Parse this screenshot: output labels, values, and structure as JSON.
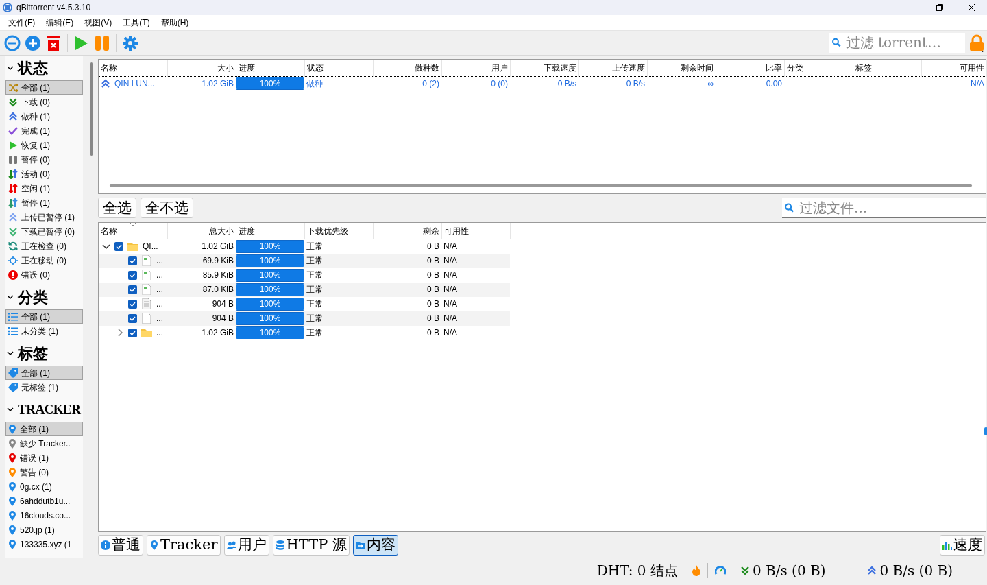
{
  "window": {
    "title": "qBittorrent v4.5.3.10"
  },
  "menu": [
    "文件(F)",
    "编辑(E)",
    "视图(V)",
    "工具(T)",
    "帮助(H)"
  ],
  "search": {
    "placeholder": "过滤 torrent…"
  },
  "sidebar": [
    {
      "heading": "状态",
      "expanded": true,
      "items": [
        {
          "label": "全部 (1)",
          "selected": true
        },
        {
          "label": "下载 (0)",
          "selected": false
        },
        {
          "label": "做种 (1)",
          "selected": false
        },
        {
          "label": "完成 (1)",
          "selected": false
        },
        {
          "label": "恢复 (1)",
          "selected": false
        },
        {
          "label": "暂停 (0)",
          "selected": false
        },
        {
          "label": "活动 (0)",
          "selected": false
        },
        {
          "label": "空闲 (1)",
          "selected": false
        },
        {
          "label": "暂停 (1)",
          "selected": false
        },
        {
          "label": "上传已暂停 (1)",
          "selected": false
        },
        {
          "label": "下载已暂停 (0)",
          "selected": false
        },
        {
          "label": "正在检查 (0)",
          "selected": false
        },
        {
          "label": "正在移动 (0)",
          "selected": false
        },
        {
          "label": "错误 (0)",
          "selected": false
        }
      ]
    },
    {
      "heading": "分类",
      "expanded": true,
      "items": [
        {
          "label": "全部 (1)",
          "selected": true
        },
        {
          "label": "未分类 (1)",
          "selected": false
        }
      ]
    },
    {
      "heading": "标签",
      "expanded": true,
      "items": [
        {
          "label": "全部 (1)",
          "selected": true
        },
        {
          "label": "无标签 (1)",
          "selected": false
        }
      ]
    },
    {
      "heading": "TRACKER",
      "expanded": true,
      "items": [
        {
          "label": "全部 (1)",
          "selected": true,
          "color": "#1e88e5"
        },
        {
          "label": "缺少 Tracker..",
          "selected": false,
          "color": "#888888"
        },
        {
          "label": "错误 (1)",
          "selected": false,
          "color": "#e50000"
        },
        {
          "label": "警告 (0)",
          "selected": false,
          "color": "#ff8c00"
        },
        {
          "label": "0g.cx (1)",
          "selected": false,
          "color": "#1e88e5"
        },
        {
          "label": "6ahddutb1u...",
          "selected": false,
          "color": "#1e88e5"
        },
        {
          "label": "16clouds.co...",
          "selected": false,
          "color": "#1e88e5"
        },
        {
          "label": "520.jp (1)",
          "selected": false,
          "color": "#1e88e5"
        },
        {
          "label": "133335.xyz (1",
          "selected": false,
          "color": "#1e88e5"
        }
      ]
    }
  ],
  "torrents": {
    "columns": [
      "名称",
      "大小",
      "进度",
      "状态",
      "做种数",
      "用户",
      "下载速度",
      "上传速度",
      "剩余时间",
      "比率",
      "分类",
      "标签",
      "可用性"
    ],
    "rows": [
      {
        "selected": false,
        "name": "QIN LUN...",
        "size": "1.02 GiB",
        "level": 1,
        "progress": "100%",
        "status": "做种",
        "seeds": "0 (2)",
        "peers": "0 (0)",
        "down": "0 B/s",
        "up": "0 B/s",
        "eta": "∞",
        "ratio": "0.00",
        "availability": "N/A"
      }
    ]
  },
  "content": {
    "select_all": "全选",
    "select_none": "全不选",
    "filter": {
      "placeholder": "过滤文件..."
    },
    "columns": [
      "名称",
      "总大小",
      "进度",
      "下载优先级",
      "剩余",
      "可用性"
    ],
    "files": [
      {
        "kind": "folder",
        "expanded": true,
        "checked": true,
        "name": "QI...",
        "size": "1.02 GiB",
        "level": 1,
        "progress": "100%",
        "priority": "正常",
        "remaining": "0 B",
        "availability": "N/A",
        "children": [
          {
            "kind": "image",
            "checked": true,
            "name": "...",
            "size": "69.9 KiB",
            "level": 1,
            "progress": "100%",
            "priority": "正常",
            "remaining": "0 B",
            "availability": "N/A"
          },
          {
            "kind": "image",
            "checked": true,
            "name": "...",
            "size": "85.9 KiB",
            "level": 1,
            "progress": "100%",
            "priority": "正常",
            "remaining": "0 B",
            "availability": "N/A"
          },
          {
            "kind": "image",
            "checked": true,
            "name": "...",
            "size": "87.0 KiB",
            "level": 1,
            "progress": "100%",
            "priority": "正常",
            "remaining": "0 B",
            "availability": "N/A"
          },
          {
            "kind": "text",
            "checked": true,
            "name": "...",
            "size": "904 B",
            "level": 1,
            "progress": "100%",
            "priority": "正常",
            "remaining": "0 B",
            "availability": "N/A"
          },
          {
            "kind": "file",
            "checked": true,
            "name": "...",
            "size": "904 B",
            "level": 1,
            "progress": "100%",
            "priority": "正常",
            "remaining": "0 B",
            "availability": "N/A"
          },
          {
            "kind": "folder",
            "expanded": false,
            "checked": true,
            "name": "...",
            "size": "1.02 GiB",
            "level": 1,
            "progress": "100%",
            "priority": "正常",
            "remaining": "0 B",
            "availability": "N/A"
          }
        ]
      }
    ]
  },
  "tabs": [
    {
      "label": "普通",
      "selected": false
    },
    {
      "label": "Tracker",
      "selected": false
    },
    {
      "label": "用户",
      "selected": false
    },
    {
      "label": "HTTP 源",
      "selected": false
    },
    {
      "label": "内容",
      "selected": true
    }
  ],
  "speed_button": "速度",
  "status_bar": {
    "dht": "DHT: 0 结点",
    "download": "0 B/s (0 B)",
    "upload": "0 B/s (0 B)"
  }
}
